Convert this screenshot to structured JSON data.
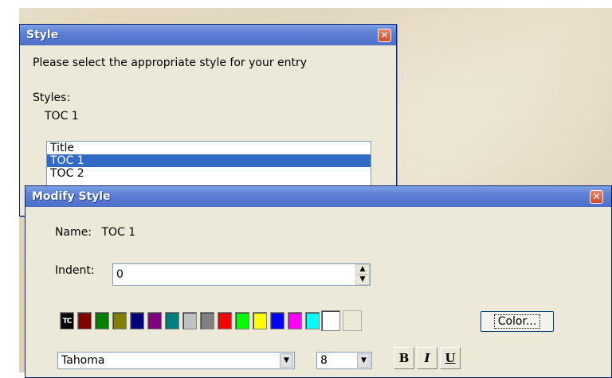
{
  "style_dialog": {
    "title": "Style",
    "close_glyph": "✕",
    "prompt": "Please select the appropriate style for your entry",
    "styles_label": "Styles:",
    "styles_value": "TOC 1",
    "list": [
      {
        "label": "Title",
        "selected": false
      },
      {
        "label": "TOC 1",
        "selected": true
      },
      {
        "label": "TOC 2",
        "selected": false
      }
    ]
  },
  "modify_dialog": {
    "title": "Modify Style",
    "close_glyph": "✕",
    "name_label": "Name:",
    "name_value": "TOC 1",
    "indent_label": "Indent:",
    "indent_value": "0",
    "current_color_text": "TC",
    "palette": [
      "#800000",
      "#008000",
      "#808000",
      "#000080",
      "#800080",
      "#008080",
      "#c0c0c0",
      "#808080",
      "#ff0000",
      "#00ff00",
      "#ffff00",
      "#0000ff",
      "#ff00ff",
      "#00ffff"
    ],
    "color_button": "Color...",
    "font": "Tahoma",
    "size": "8",
    "bold_label": "B",
    "italic_label": "I",
    "underline_label": "U",
    "accent_color": "#316ac5"
  }
}
